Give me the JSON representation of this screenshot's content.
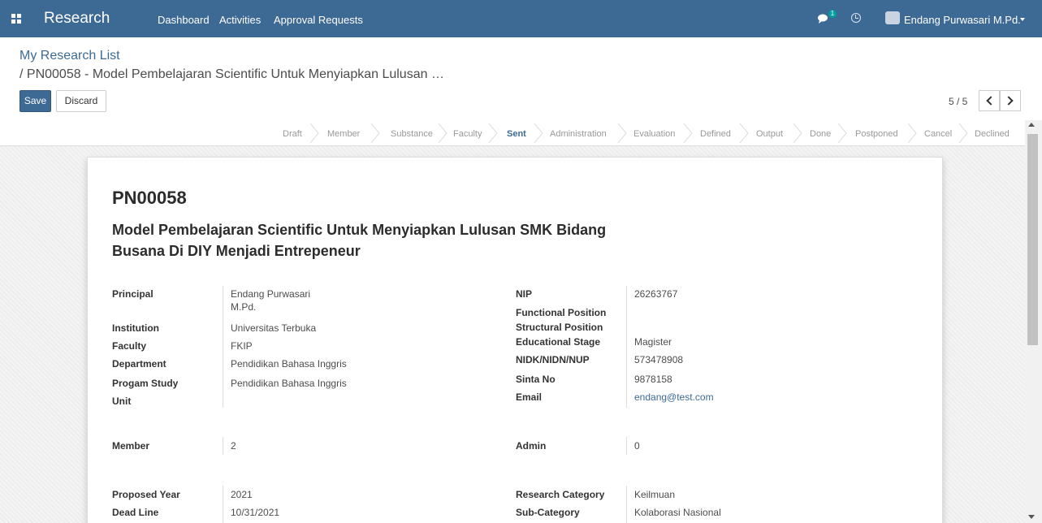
{
  "navbar": {
    "brand": "Research",
    "menu": [
      "Dashboard",
      "Activities",
      "Approval Requests"
    ],
    "chat_count": "1",
    "user_name": "Endang Purwasari M.Pd.",
    "color": "#3d6a95"
  },
  "breadcrumb": {
    "root": "My Research List",
    "current": "/ PN00058 - Model Pembelajaran Scientific Untuk Menyiapkan Lulusan …"
  },
  "buttons": {
    "save": "Save",
    "discard": "Discard"
  },
  "pager": {
    "value": "5 / 5"
  },
  "statusbar": {
    "stages": [
      "Draft",
      "Member",
      "Substance",
      "Faculty",
      "Sent",
      "Administration",
      "Evaluation",
      "Defined",
      "Output",
      "Done",
      "Postponed",
      "Cancel",
      "Declined"
    ],
    "active": "Sent"
  },
  "record": {
    "code": "PN00058",
    "title": "Model Pembelajaran Scientific Untuk Menyiapkan Lulusan SMK Bidang Busana Di DIY Menjadi Entrepeneur"
  },
  "left_fields": [
    {
      "label": "Principal",
      "value": "Endang Purwasari",
      "value2": "M.Pd."
    },
    {
      "label": "Institution",
      "value": "Universitas Terbuka"
    },
    {
      "label": "Faculty",
      "value": "FKIP"
    },
    {
      "label": "Department",
      "value": "Pendidikan Bahasa Inggris"
    },
    {
      "label": "Progam Study",
      "value": "Pendidikan Bahasa Inggris"
    },
    {
      "label": "Unit",
      "value": ""
    }
  ],
  "right_fields": [
    {
      "label": "NIP",
      "value": "26263767"
    },
    {
      "label": "Functional Position",
      "value": ""
    },
    {
      "label": "Structural Position",
      "value": ""
    },
    {
      "label": "Educational Stage",
      "value": "Magister"
    },
    {
      "label": "NIDK/NIDN/NUP",
      "value": "573478908"
    },
    {
      "label": "Sinta No",
      "value": "9878158"
    },
    {
      "label": "Email",
      "value": "endang@test.com"
    }
  ],
  "member_row": {
    "member_label": "Member",
    "member_value": "2",
    "admin_label": "Admin",
    "admin_value": "0"
  },
  "bottom_left": [
    {
      "label": "Proposed Year",
      "value": "2021"
    },
    {
      "label": "Dead Line",
      "value": "10/31/2021"
    }
  ],
  "bottom_right": [
    {
      "label": "Research Category",
      "value": "Keilmuan"
    },
    {
      "label": "Sub-Category",
      "value": "Kolaborasi Nasional"
    }
  ]
}
